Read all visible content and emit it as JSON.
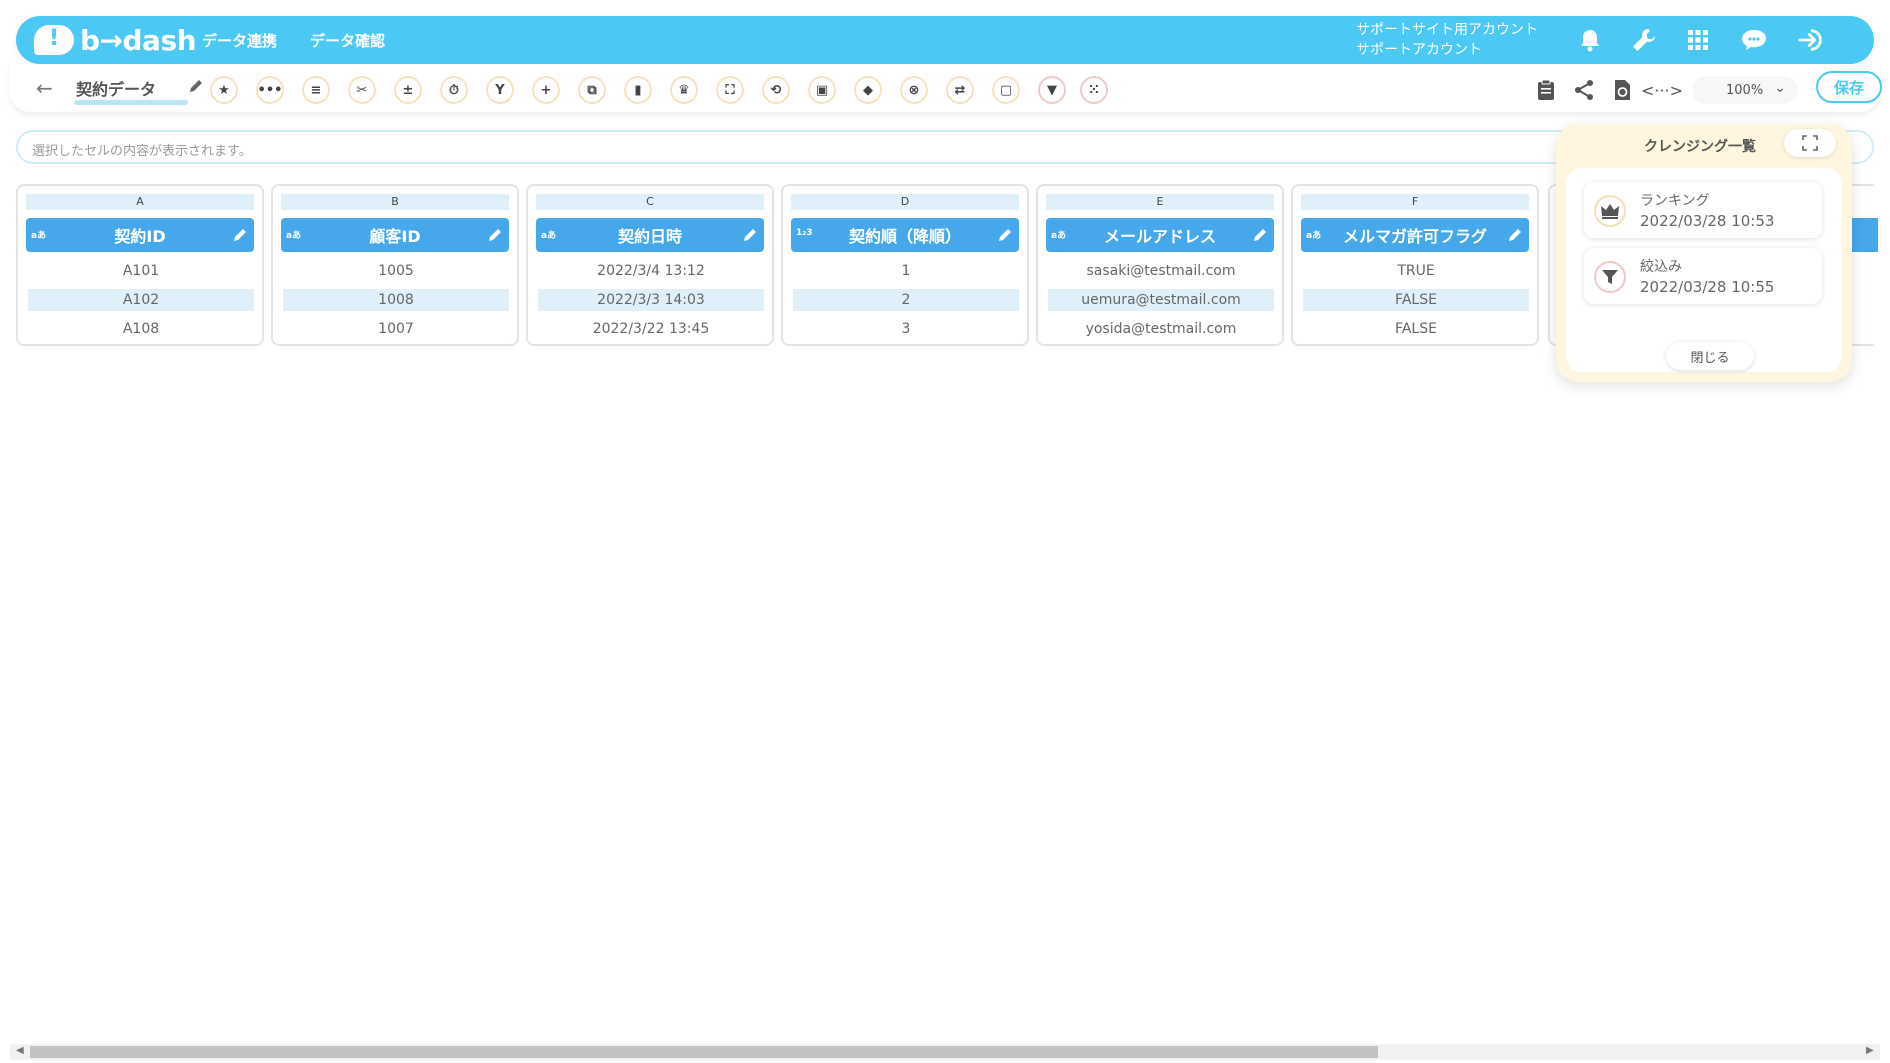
{
  "header": {
    "logo_text": "b→dash",
    "nav": [
      "データ連携",
      "データ確認"
    ],
    "account_line1": "サポートサイト用アカウント",
    "account_line2": "サポートアカウント",
    "icons": [
      "bell-icon",
      "wrench-icon",
      "grid-icon",
      "chat-icon",
      "logout-icon"
    ]
  },
  "toolbar": {
    "title": "契約データ",
    "tools": [
      "star-icon",
      "more-icon",
      "list-icon",
      "cut-icon",
      "calc-icon",
      "timer-icon",
      "merge-icon",
      "plus-icon",
      "copy-icon",
      "trash-icon",
      "crown-icon",
      "expand-icon",
      "loop-icon",
      "lock-icon",
      "box-icon",
      "cancel-icon",
      "translate-icon",
      "frame-icon",
      "filter-icon",
      "dots-grid-icon"
    ],
    "zoom": "100%",
    "save_label": "保存"
  },
  "cell_bar": {
    "placeholder": "選択したセルの内容が表示されます。"
  },
  "columns": [
    {
      "letter": "A",
      "type": "aあ",
      "name": "契約ID",
      "cells": [
        "A101",
        "A102",
        "A108"
      ]
    },
    {
      "letter": "B",
      "type": "aあ",
      "name": "顧客ID",
      "cells": [
        "1005",
        "1008",
        "1007"
      ]
    },
    {
      "letter": "C",
      "type": "aあ",
      "name": "契約日時",
      "cells": [
        "2022/3/4 13:12",
        "2022/3/3 14:03",
        "2022/3/22 13:45"
      ]
    },
    {
      "letter": "D",
      "type": "1₂3",
      "name": "契約順（降順）",
      "cells": [
        "1",
        "2",
        "3"
      ]
    },
    {
      "letter": "E",
      "type": "aあ",
      "name": "メールアドレス",
      "cells": [
        "sasaki@testmail.com",
        "uemura@testmail.com",
        "yosida@testmail.com"
      ]
    },
    {
      "letter": "F",
      "type": "aあ",
      "name": "メルマガ許可フラグ",
      "cells": [
        "TRUE",
        "FALSE",
        "FALSE"
      ]
    }
  ],
  "panel": {
    "title": "クレンジング一覧",
    "items": [
      {
        "name": "ランキング",
        "time": "2022/03/28 10:53",
        "icon": "crown-icon"
      },
      {
        "name": "絞込み",
        "time": "2022/03/28 10:55",
        "icon": "filter-icon"
      }
    ],
    "close_label": "閉じる"
  },
  "colors": {
    "header": "#4cc8f5",
    "column_header": "#46a8ea",
    "panel": "#fff6df"
  }
}
